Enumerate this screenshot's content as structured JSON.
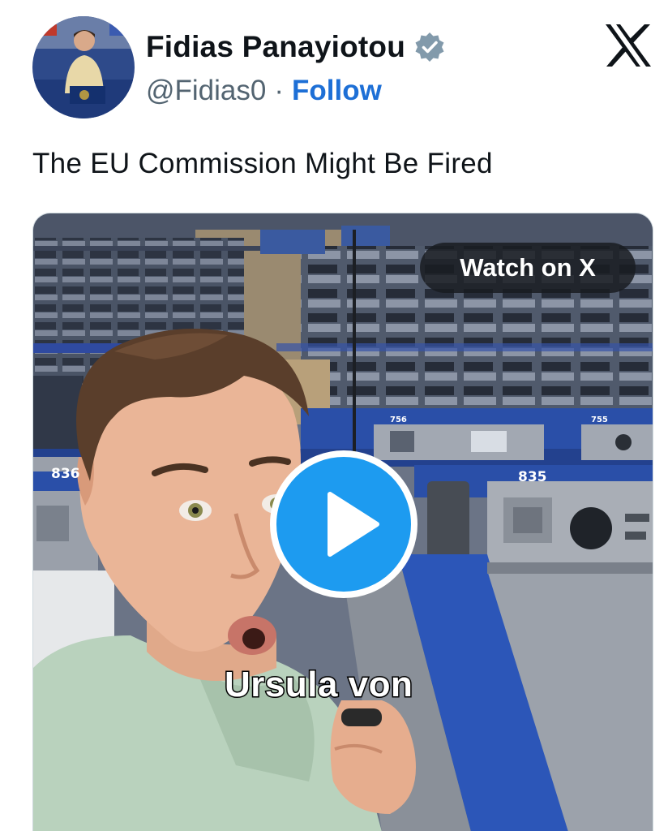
{
  "author": {
    "display_name": "Fidias Panayiotou",
    "handle": "@Fidias0",
    "separator": "·",
    "follow_label": "Follow",
    "verified": true,
    "avatar_icon": "user-avatar"
  },
  "platform": {
    "logo_icon": "x-logo-icon"
  },
  "tweet": {
    "text": "The EU Commission Might Be Fired"
  },
  "media": {
    "type": "video",
    "watch_label": "Watch on X",
    "play_icon": "play-icon",
    "caption": "Ursula von",
    "seat_labels": [
      "836",
      "835",
      "756",
      "755"
    ]
  },
  "colors": {
    "follow_blue": "#1d6fd6",
    "play_blue": "#1d9bf0",
    "verified_gray": "#829aab",
    "seat_blue": "#2a4fa8"
  }
}
